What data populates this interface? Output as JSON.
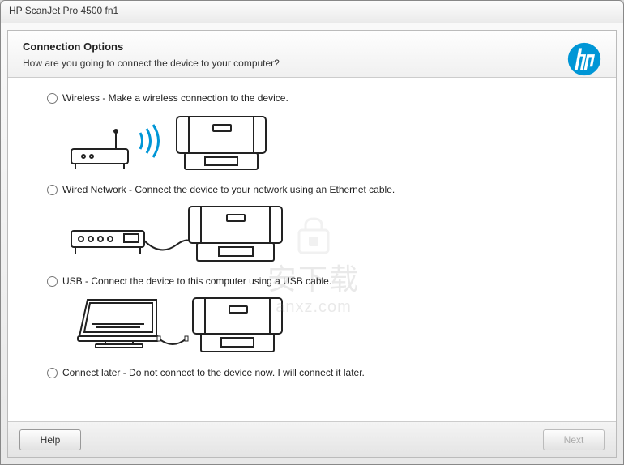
{
  "window": {
    "title": "HP ScanJet Pro 4500 fn1"
  },
  "header": {
    "title": "Connection Options",
    "subtitle": "How are you going to connect the device to your computer?"
  },
  "options": {
    "wireless": "Wireless - Make a wireless connection to the device.",
    "wired": "Wired Network - Connect the device to your network using an Ethernet cable.",
    "usb": "USB - Connect the device to this computer using a USB cable.",
    "later": "Connect later - Do not connect to the device now. I will connect it later."
  },
  "buttons": {
    "help": "Help",
    "next": "Next"
  },
  "watermark": {
    "chars": "安下载",
    "url": "anxz.com"
  },
  "brand": {
    "logo_color": "#0096D6"
  }
}
